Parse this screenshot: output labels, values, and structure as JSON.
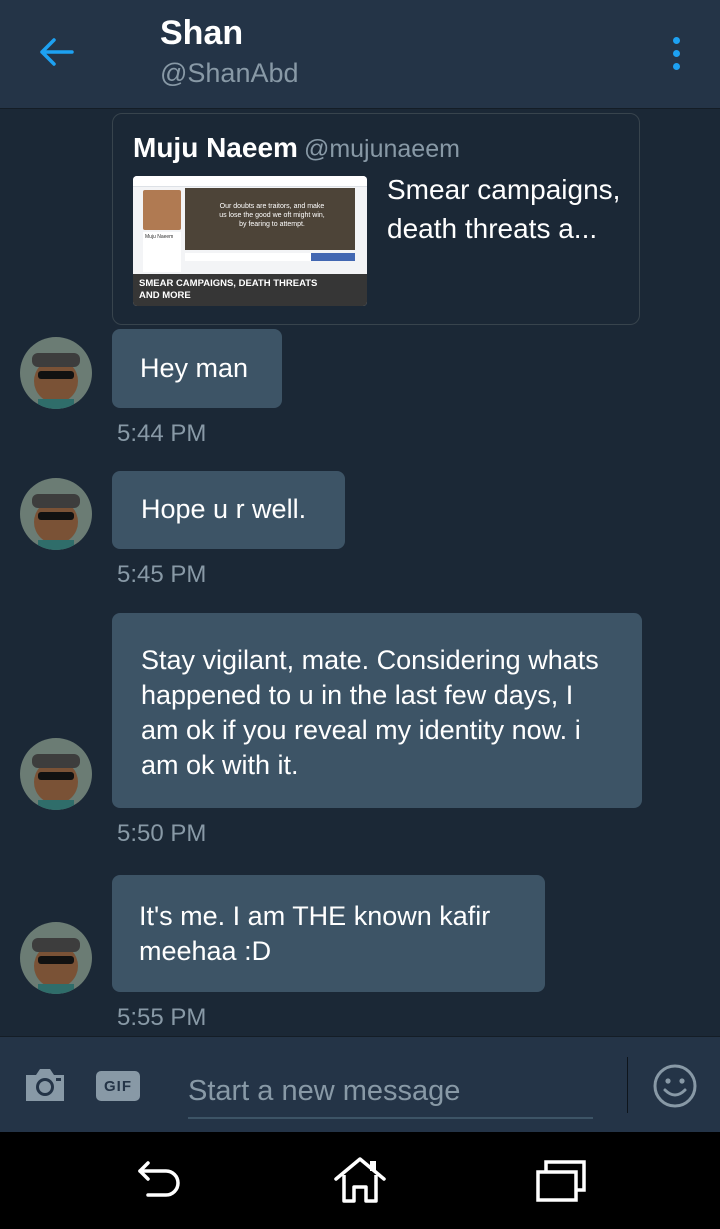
{
  "header": {
    "name": "Shan",
    "handle": "@ShanAbd",
    "back_icon": "arrow-left-icon",
    "menu_icon": "more-vertical-icon"
  },
  "shared_tweet": {
    "author": "Muju Naeem",
    "handle": "@mujunaeem",
    "text": "Smear campaigns, death threats a...",
    "thumbnail_caption": "SMEAR CAMPAIGNS, DEATH THREATS AND MORE",
    "thumbnail_quote": "Our doubts are traitors, and make us lose the good we oft might win, by fearing to attempt.",
    "thumbnail_profile_name": "Muju Naeem"
  },
  "messages": [
    {
      "text": "Hey man",
      "time": "5:44 PM"
    },
    {
      "text": "Hope u r well.",
      "time": "5:45 PM"
    },
    {
      "text": "Stay vigilant, mate. Considering whats happened to u in the last few days, I am ok if you reveal my identity now. i am ok with it.",
      "time": "5:50 PM"
    },
    {
      "text": "It's me. I am THE known kafir meehaa :D",
      "time": "5:55 PM"
    }
  ],
  "composer": {
    "placeholder": "Start a new message",
    "camera_icon": "camera-icon",
    "gif_label": "GIF",
    "emoji_icon": "emoji-icon"
  },
  "navbar": {
    "back_icon": "nav-back-icon",
    "home_icon": "nav-home-icon",
    "recents_icon": "nav-recents-icon"
  },
  "colors": {
    "background": "#1b2836",
    "header": "#243447",
    "bubble": "#3d5466",
    "accent": "#1da1f2",
    "secondary_text": "#8899a6"
  }
}
